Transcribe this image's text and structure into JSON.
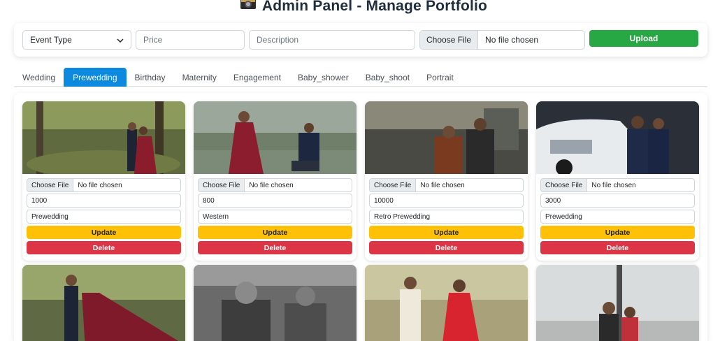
{
  "header": {
    "title": "Admin Panel - Manage Portfolio",
    "icon": "camera-icon"
  },
  "upload": {
    "event_type_value": "Event Type",
    "price_placeholder": "Price",
    "description_placeholder": "Description",
    "file_button": "Choose File",
    "file_status": "No file chosen",
    "upload_label": "Upload"
  },
  "tabs": [
    {
      "label": "Wedding",
      "active": false
    },
    {
      "label": "Prewedding",
      "active": true
    },
    {
      "label": "Birthday",
      "active": false
    },
    {
      "label": "Maternity",
      "active": false
    },
    {
      "label": "Engagement",
      "active": false
    },
    {
      "label": "Baby_shower",
      "active": false
    },
    {
      "label": "Baby_shoot",
      "active": false
    },
    {
      "label": "Portrait",
      "active": false
    }
  ],
  "cards": [
    {
      "file_button": "Choose File",
      "file_status": "No file chosen",
      "price": "1000",
      "description": "Prewedding",
      "update_label": "Update",
      "delete_label": "Delete"
    },
    {
      "file_button": "Choose File",
      "file_status": "No file chosen",
      "price": "800",
      "description": "Western",
      "update_label": "Update",
      "delete_label": "Delete"
    },
    {
      "file_button": "Choose File",
      "file_status": "No file chosen",
      "price": "10000",
      "description": "Retro Prewedding",
      "update_label": "Update",
      "delete_label": "Delete"
    },
    {
      "file_button": "Choose File",
      "file_status": "No file chosen",
      "price": "3000",
      "description": "Prewedding",
      "update_label": "Update",
      "delete_label": "Delete"
    }
  ],
  "colors": {
    "accent": "#0d8adf",
    "upload": "#28a745",
    "update": "#ffc107",
    "delete": "#dc3545"
  }
}
